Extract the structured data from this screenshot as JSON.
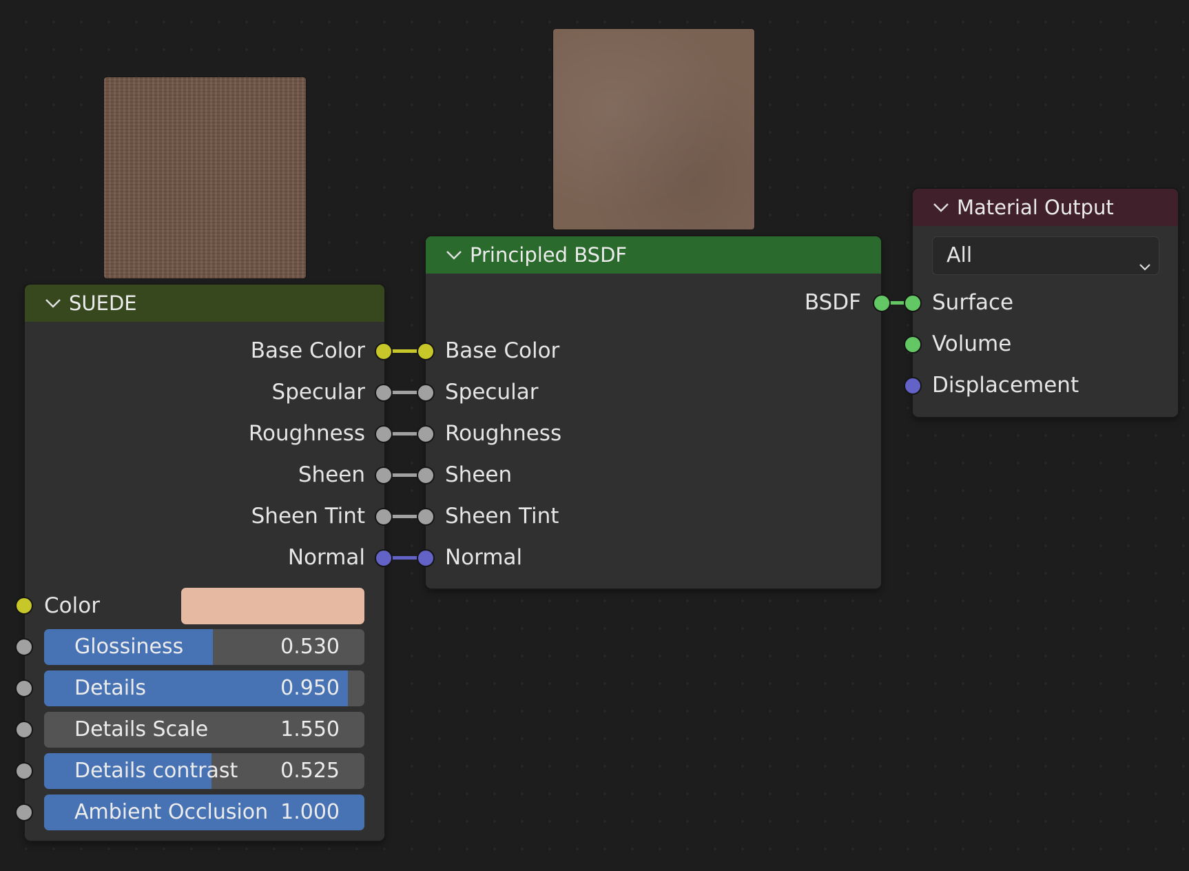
{
  "nodes": {
    "suede": {
      "title": "SUEDE",
      "header_color": "#37481f",
      "outputs": [
        "Base Color",
        "Specular",
        "Roughness",
        "Sheen",
        "Sheen Tint",
        "Normal"
      ],
      "color_label": "Color",
      "color_value": "#e6b9a2",
      "fields": [
        {
          "label": "Glossiness",
          "value": "0.530",
          "fraction": 0.53
        },
        {
          "label": "Details",
          "value": "0.950",
          "fraction": 0.95
        },
        {
          "label": "Details Scale",
          "value": "1.550",
          "fraction": 0.0
        },
        {
          "label": "Details contrast",
          "value": "0.525",
          "fraction": 0.525
        },
        {
          "label": "Ambient Occlusion",
          "value": "1.000",
          "fraction": 1.0
        }
      ]
    },
    "principled": {
      "title": "Principled BSDF",
      "header_color": "#2a6a2c",
      "output": "BSDF",
      "inputs": [
        "Base Color",
        "Specular",
        "Roughness",
        "Sheen",
        "Sheen Tint",
        "Normal"
      ]
    },
    "material_output": {
      "title": "Material Output",
      "header_color": "#40202a",
      "target": "All",
      "inputs": [
        "Surface",
        "Volume",
        "Displacement"
      ]
    }
  },
  "socket_colors": {
    "color": "#c7c729",
    "float": "#a1a1a1",
    "vector": "#6363c7",
    "shader": "#63c763"
  },
  "icons": {
    "collapse": "chevron-down-icon",
    "dropdown": "chevron-down-icon"
  }
}
